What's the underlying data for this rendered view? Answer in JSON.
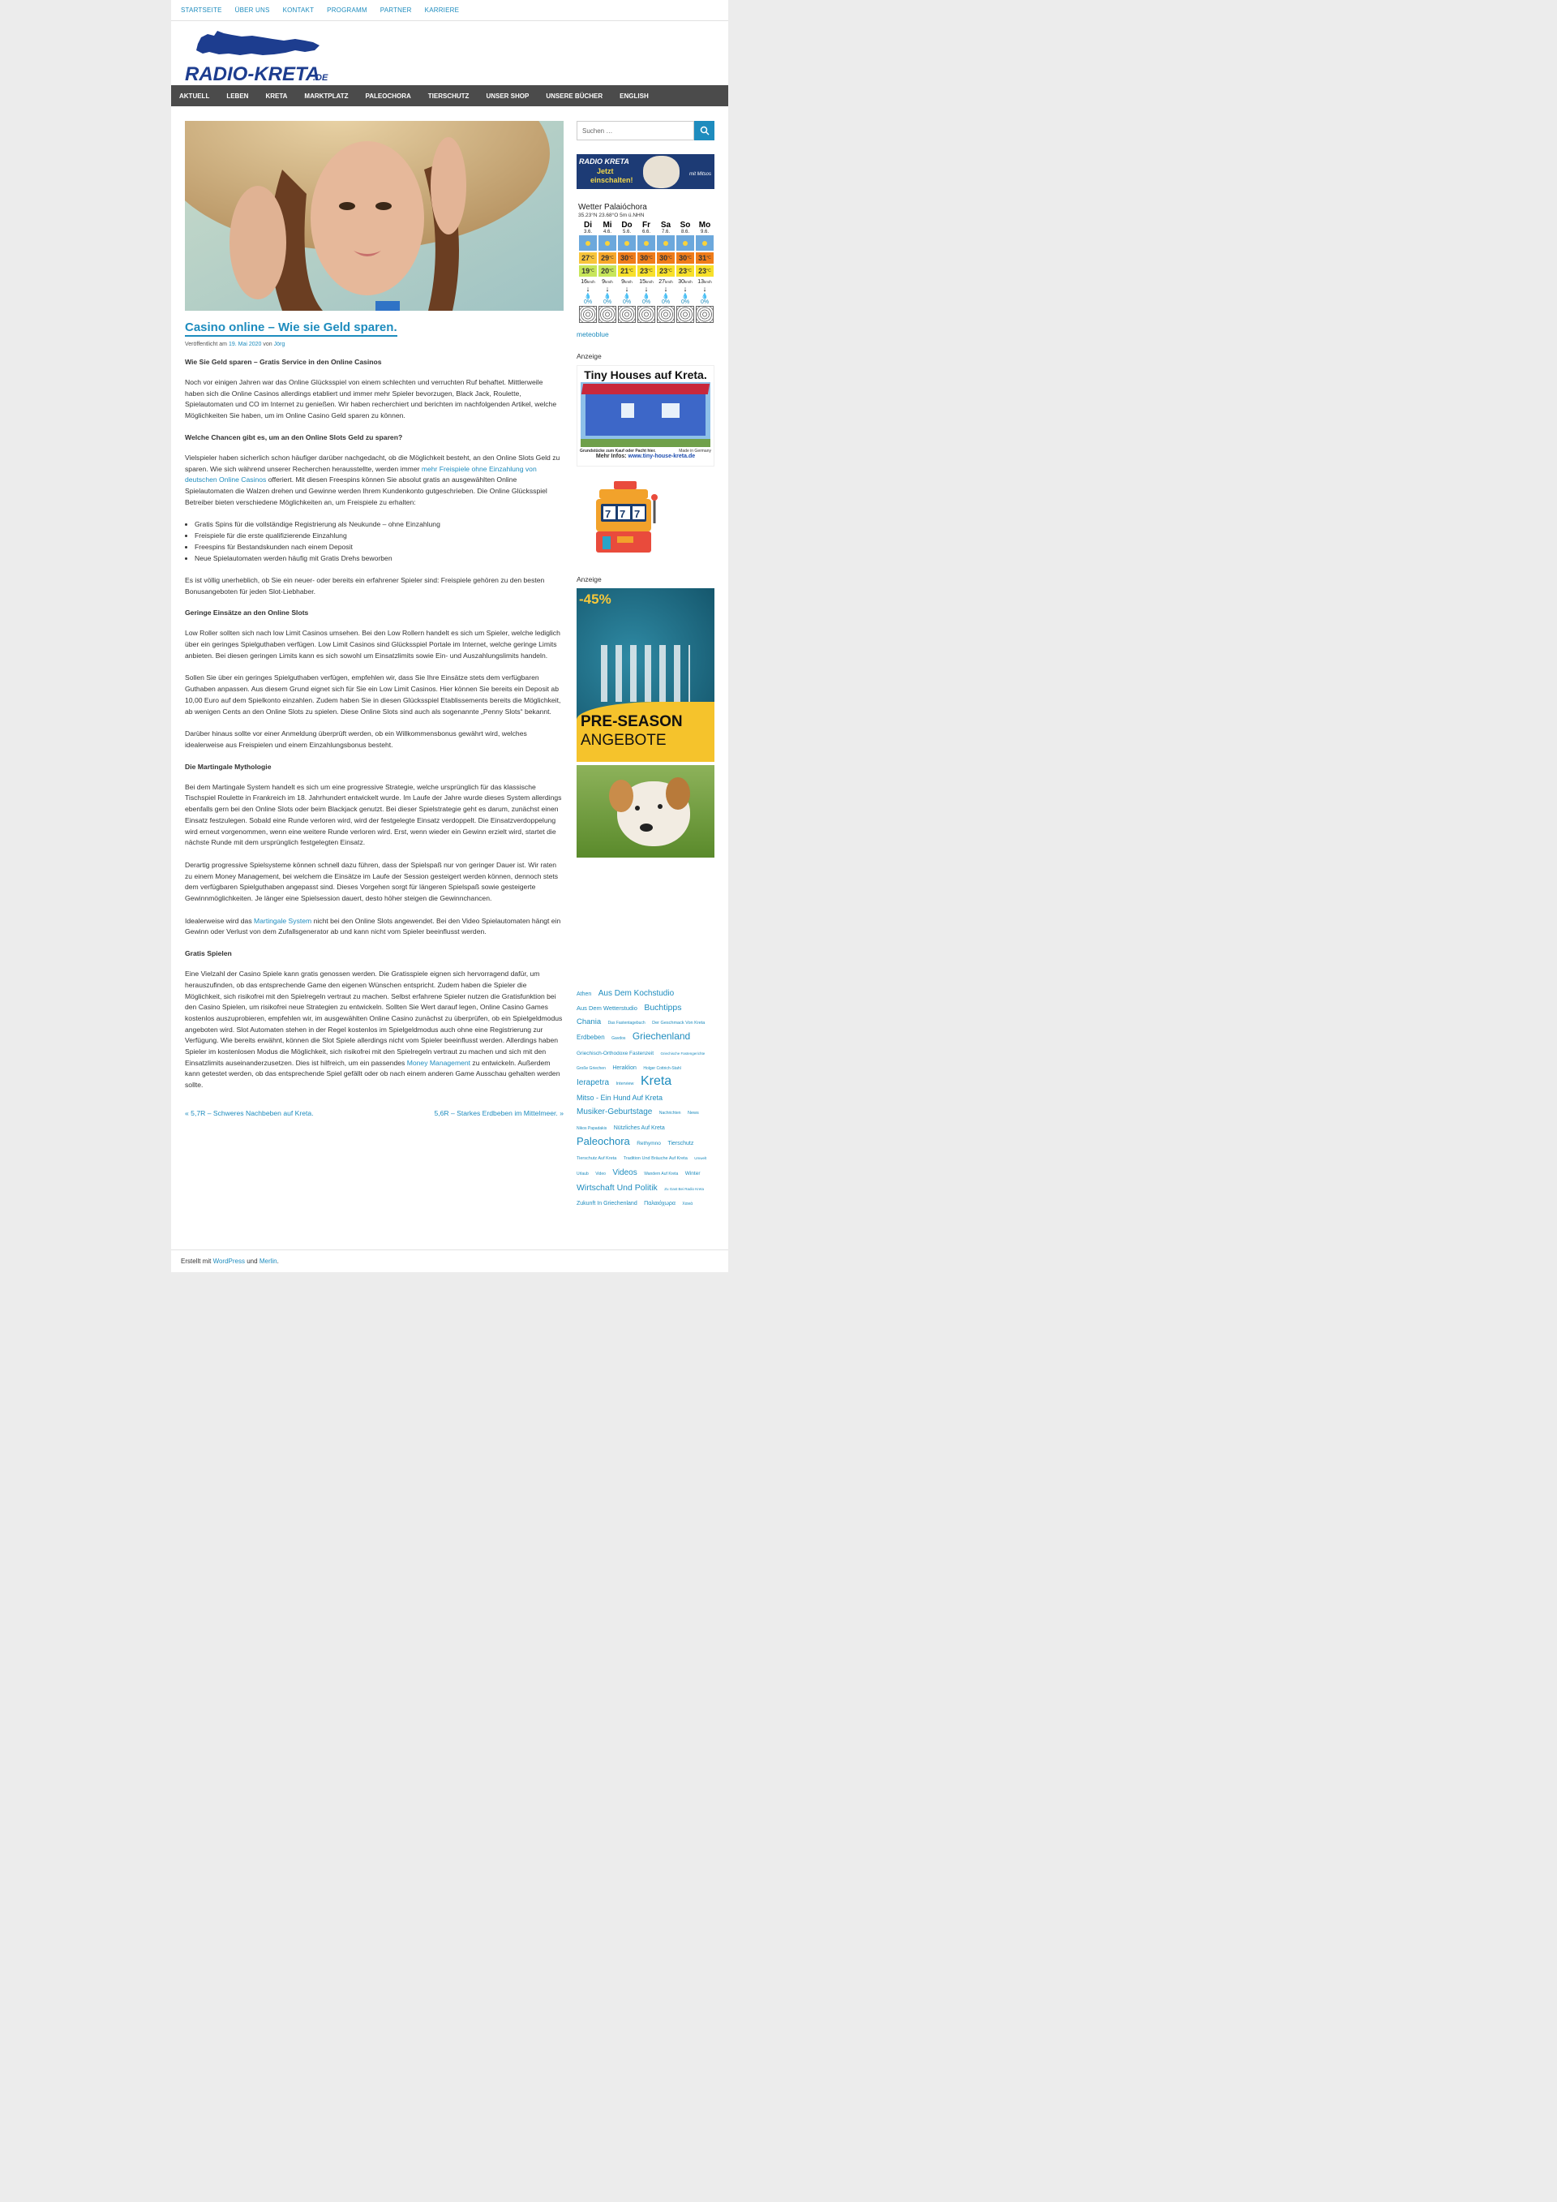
{
  "topnav": [
    "STARTSEITE",
    "ÜBER UNS",
    "KONTAKT",
    "PROGRAMM",
    "PARTNER",
    "KARRIERE"
  ],
  "logo": {
    "text": "RADIO-KRETA",
    "suffix": ".DE"
  },
  "mainnav": [
    "AKTUELL",
    "LEBEN",
    "KRETA",
    "MARKTPLATZ",
    "PALEOCHORA",
    "TIERSCHUTZ",
    "UNSER SHOP",
    "UNSERE BÜCHER",
    "ENGLISH"
  ],
  "post": {
    "title": "Casino online – Wie sie Geld sparen.",
    "meta_prefix": "Veröffentlicht am",
    "date": "19. Mai 2020",
    "meta_by": "von",
    "author": "Jörg",
    "h1": "Wie Sie Geld sparen – Gratis Service in den Online Casinos",
    "p1": "Noch vor einigen Jahren war das Online Glücksspiel von einem schlechten und verruchten Ruf behaftet. Mittlerweile haben sich die Online Casinos allerdings etabliert und immer mehr Spieler bevorzugen, Black Jack, Roulette, Spielautomaten und CO im Internet zu genießen. Wir haben recherchiert und berichten im nachfolgenden Artikel, welche Möglichkeiten Sie haben, um im Online Casino Geld sparen zu können.",
    "h2": "Welche Chancen gibt es, um an den Online Slots Geld zu sparen?",
    "p2a": "Vielspieler haben sicherlich schon häufiger darüber nachgedacht, ob die Möglichkeit besteht, an den Online Slots Geld zu sparen. Wie sich während unserer Recherchen herausstellte, werden immer ",
    "p2link": "mehr Freispiele ohne Einzahlung von deutschen Online Casinos",
    "p2b": " offeriert. Mit diesen Freespins können Sie absolut gratis an ausgewählten Online Spielautomaten die Walzen drehen und Gewinne werden Ihrem Kundenkonto gutgeschrieben. Die Online Glücksspiel Betreiber bieten verschiedene Möglichkeiten an, um Freispiele zu erhalten:",
    "list": [
      "Gratis Spins für die vollständige Registrierung als Neukunde – ohne Einzahlung",
      "Freispiele für die erste qualifizierende Einzahlung",
      "Freespins für Bestandskunden nach einem Deposit",
      "Neue Spielautomaten werden häufig mit Gratis Drehs beworben"
    ],
    "p3": "Es ist völlig unerheblich, ob Sie ein neuer- oder bereits ein erfahrener Spieler sind: Freispiele gehören zu den besten Bonusangeboten für jeden Slot-Liebhaber.",
    "h3": "Geringe Einsätze an den Online Slots",
    "p4": "Low Roller sollten sich nach low Limit Casinos umsehen. Bei den Low Rollern handelt es sich um Spieler, welche lediglich über ein geringes Spielguthaben verfügen. Low Limit Casinos sind Glücksspiel Portale im Internet, welche geringe Limits anbieten. Bei diesen geringen Limits kann es sich sowohl um Einsatzlimits sowie Ein- und Auszahlungslimits handeln.",
    "p5": "Sollen Sie über ein geringes Spielguthaben verfügen, empfehlen wir, dass Sie Ihre Einsätze stets dem verfügbaren Guthaben anpassen. Aus diesem Grund eignet sich für Sie ein Low Limit Casinos. Hier können Sie bereits ein Deposit ab 10,00 Euro auf dem Spielkonto einzahlen. Zudem haben Sie in diesen Glücksspiel Etablissements bereits die Möglichkeit, ab wenigen Cents an den Online Slots zu spielen. Diese Online Slots sind auch als sogenannte „Penny Slots“ bekannt.",
    "p6": "Darüber hinaus sollte vor einer Anmeldung überprüft werden, ob ein Willkommensbonus gewährt wird, welches idealerweise aus Freispielen und einem Einzahlungsbonus besteht.",
    "h4": "Die Martingale Mythologie",
    "p7": "Bei dem Martingale System handelt es sich um eine progressive Strategie, welche ursprünglich für das klassische Tischspiel Roulette in Frankreich im 18. Jahrhundert entwickelt wurde. Im Laufe der Jahre wurde dieses System allerdings ebenfalls gern bei den Online Slots oder beim Blackjack genutzt. Bei dieser Spielstrategie geht es darum, zunächst einen Einsatz festzulegen. Sobald eine Runde verloren wird, wird der festgelegte Einsatz verdoppelt. Die Einsatzverdoppelung wird erneut vorgenommen, wenn eine weitere Runde verloren wird. Erst, wenn wieder ein Gewinn erzielt wird, startet die nächste Runde mit dem ursprünglich festgelegten Einsatz.",
    "p8": "Derartig progressive Spielsysteme können schnell dazu führen, dass der Spielspaß nur von geringer Dauer ist. Wir raten zu einem Money Management, bei welchem die Einsätze im Laufe der Session gesteigert werden können, dennoch stets dem verfügbaren Spielguthaben angepasst sind. Dieses Vorgehen sorgt für längeren Spielspaß sowie gesteigerte Gewinnmöglichkeiten. Je länger eine Spielsession dauert, desto höher steigen die Gewinnchancen.",
    "p9a": "Idealerweise wird das ",
    "p9link": "Martingale System",
    "p9b": " nicht bei den Online Slots angewendet. Bei den Video Spielautomaten hängt ein Gewinn oder Verlust von dem Zufallsgenerator ab und kann nicht vom Spieler beeinflusst werden.",
    "h5": "Gratis Spielen",
    "p10a": "Eine Vielzahl der Casino Spiele kann gratis genossen werden. Die Gratisspiele eignen sich hervorragend dafür, um herauszufinden, ob das entsprechende Game den eigenen Wünschen entspricht. Zudem haben die Spieler die Möglichkeit, sich risikofrei mit den Spielregeln vertraut zu machen. Selbst erfahrene Spieler nutzen die Gratisfunktion bei den Casino Spielen, um risikofrei neue Strategien zu entwickeln. Sollten Sie Wert darauf legen, Online Casino Games kostenlos auszuprobieren, empfehlen wir, im ausgewählten Online Casino zunächst zu überprüfen, ob ein Spielgeldmodus angeboten wird. Slot Automaten stehen in der Regel kostenlos im Spielgeldmodus auch ohne eine Registrierung zur Verfügung. Wie bereits erwähnt, können die Slot Spiele allerdings nicht vom Spieler beeinflusst werden. Allerdings haben Spieler im kostenlosen Modus die Möglichkeit, sich risikofrei mit den Spielregeln vertraut zu machen und sich mit den Einsatzlimits auseinanderzusetzen. Dies ist hilfreich, um ein passendes ",
    "p10link": "Money Management",
    "p10b": " zu entwickeln. Außerdem kann getestet werden, ob das entsprechende Spiel gefällt oder ob nach einem anderen Game Ausschau gehalten werden sollte.",
    "prev": "« 5,7R – Schweres Nachbeben auf Kreta.",
    "next": "5,6R – Starkes Erdbeben im Mittelmeer. »"
  },
  "sidebar": {
    "search_placeholder": "Suchen …",
    "radio_line1": "RADIO KRETA",
    "radio_line2": "Jetzt",
    "radio_line3": "einschalten!",
    "radio_sig": "mit Mitsos",
    "weather": {
      "title": "Wetter Palaióchora",
      "coords": "35.23°N 23.68°O 5m ü.NHN",
      "days": [
        "Di",
        "Mi",
        "Do",
        "Fr",
        "Sa",
        "So",
        "Mo"
      ],
      "dates": [
        "3.6.",
        "4.6.",
        "5.6.",
        "6.6.",
        "7.6.",
        "8.6.",
        "9.6."
      ],
      "tmax": [
        "27",
        "29",
        "30",
        "30",
        "30",
        "30",
        "31"
      ],
      "tmin": [
        "19",
        "20",
        "21",
        "23",
        "23",
        "23",
        "23"
      ],
      "unit": "°C",
      "wind": [
        "16",
        "9",
        "9",
        "15",
        "27",
        "30",
        "13"
      ],
      "wind_unit": "km/h",
      "rain": [
        "0%",
        "0%",
        "0%",
        "0%",
        "0%",
        "0%",
        "0%"
      ],
      "credit": "meteoblue"
    },
    "ad_label": "Anzeige",
    "tiny_title": "Tiny Houses auf Kreta.",
    "tiny_sub1": "Grundstücke zum Kauf oder Pacht hier.",
    "tiny_made": "Made in Germany",
    "tiny_info": "Mehr Infos:",
    "tiny_url": "www.tiny-house-kreta.de",
    "slot_text": "777",
    "ad2_label": "Anzeige",
    "ad2_discount": "-45%",
    "ad2_line1": "PRE-SEASON",
    "ad2_line2": "ANGEBOTE",
    "tags": [
      {
        "t": "Athen",
        "s": 7
      },
      {
        "t": "Aus Dem Kochstudio",
        "s": 10
      },
      {
        "t": "Aus Dem Wetterstudio",
        "s": 7.5
      },
      {
        "t": "Buchtipps",
        "s": 10.5
      },
      {
        "t": "Chania",
        "s": 9.5
      },
      {
        "t": "Das Fastentagebuch",
        "s": 5
      },
      {
        "t": "Der Geschmack Von Kreta",
        "s": 5.5
      },
      {
        "t": "Erdbeben",
        "s": 8
      },
      {
        "t": "Gavdos",
        "s": 5
      },
      {
        "t": "Griechenland",
        "s": 12
      },
      {
        "t": "Griechisch-Orthodoxe Fastenzeit",
        "s": 6.5
      },
      {
        "t": "Griechische Fastengerichte",
        "s": 4.5
      },
      {
        "t": "Große Griechen",
        "s": 5
      },
      {
        "t": "Heraklion",
        "s": 7
      },
      {
        "t": "Holger Cottrich-Stahl",
        "s": 5
      },
      {
        "t": "Ierapetra",
        "s": 10
      },
      {
        "t": "Interview",
        "s": 5.5
      },
      {
        "t": "Kreta",
        "s": 16
      },
      {
        "t": "Mitso - Ein Hund Auf Kreta",
        "s": 9
      },
      {
        "t": "Musiker-Geburtstage",
        "s": 10
      },
      {
        "t": "Nachrichten",
        "s": 5
      },
      {
        "t": "News",
        "s": 5.5
      },
      {
        "t": "Nikos Papadakis",
        "s": 5
      },
      {
        "t": "Nützliches Auf Kreta",
        "s": 7
      },
      {
        "t": "Paleochora",
        "s": 13
      },
      {
        "t": "Rethymno",
        "s": 6.5
      },
      {
        "t": "Tierschutz",
        "s": 7
      },
      {
        "t": "Tierschutz Auf Kreta",
        "s": 5.5
      },
      {
        "t": "Tradition Und Bräuche Auf Kreta",
        "s": 5.5
      },
      {
        "t": "Umwelt",
        "s": 4.5
      },
      {
        "t": "Urlaub",
        "s": 5
      },
      {
        "t": "Video",
        "s": 5
      },
      {
        "t": "Videos",
        "s": 10
      },
      {
        "t": "Wandern Auf Kreta",
        "s": 5
      },
      {
        "t": "Winter",
        "s": 6.5
      },
      {
        "t": "Wirtschaft Und Politik",
        "s": 10.5
      },
      {
        "t": "Zu Gast Bei Radio Kreta",
        "s": 4.5
      },
      {
        "t": "Zukunft In Griechenland",
        "s": 7
      },
      {
        "t": "Παλαιόχωρα",
        "s": 7
      },
      {
        "t": "Χανιά",
        "s": 5
      }
    ]
  },
  "footer": {
    "prefix": "Erstellt mit",
    "wp": "WordPress",
    "and": "und",
    "theme": "Merlin",
    "suffix": "."
  },
  "colors": {
    "accent": "#1e8cbe",
    "nav": "#4b4b4b",
    "logo": "#1d3d8f"
  }
}
